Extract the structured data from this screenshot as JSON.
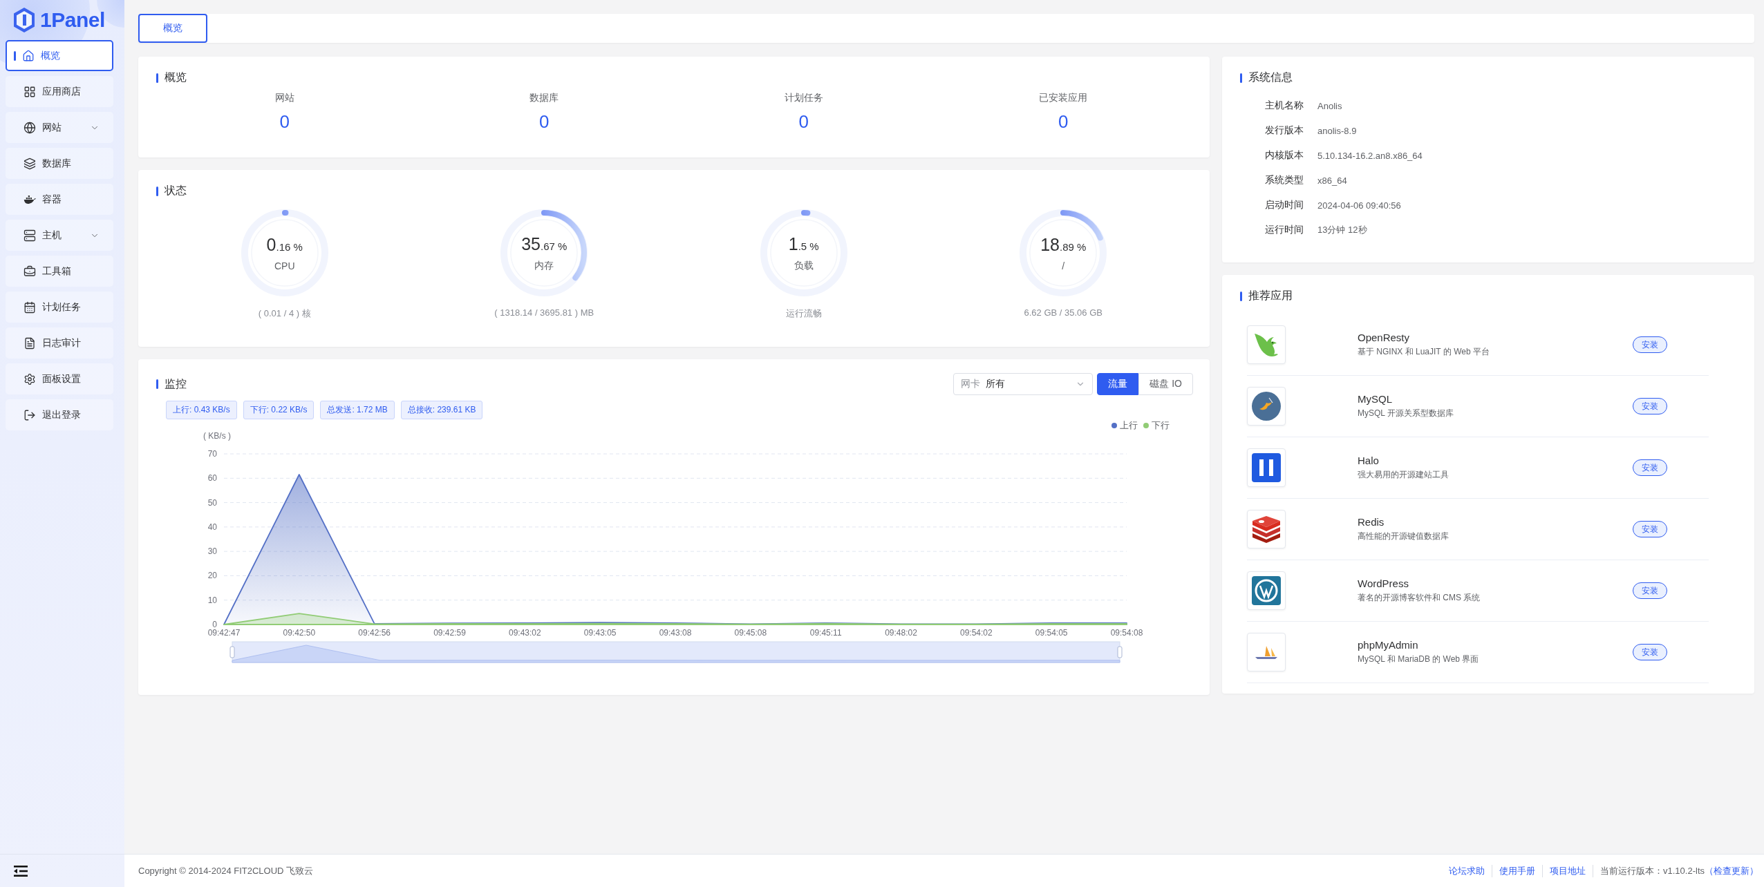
{
  "brand": {
    "name": "1Panel"
  },
  "sidebar": {
    "items": [
      {
        "label": "概览",
        "selected": true,
        "has_submenu": false
      },
      {
        "label": "应用商店",
        "selected": false,
        "has_submenu": false
      },
      {
        "label": "网站",
        "selected": false,
        "has_submenu": true
      },
      {
        "label": "数据库",
        "selected": false,
        "has_submenu": false
      },
      {
        "label": "容器",
        "selected": false,
        "has_submenu": false
      },
      {
        "label": "主机",
        "selected": false,
        "has_submenu": true
      },
      {
        "label": "工具箱",
        "selected": false,
        "has_submenu": false
      },
      {
        "label": "计划任务",
        "selected": false,
        "has_submenu": false
      },
      {
        "label": "日志审计",
        "selected": false,
        "has_submenu": false
      },
      {
        "label": "面板设置",
        "selected": false,
        "has_submenu": false
      },
      {
        "label": "退出登录",
        "selected": false,
        "has_submenu": false
      }
    ]
  },
  "top_tabs": [
    {
      "label": "概览",
      "selected": true
    }
  ],
  "overview": {
    "title": "概览",
    "stats": [
      {
        "label": "网站",
        "value": "0"
      },
      {
        "label": "数据库",
        "value": "0"
      },
      {
        "label": "计划任务",
        "value": "0"
      },
      {
        "label": "已安装应用",
        "value": "0"
      }
    ]
  },
  "status": {
    "title": "状态",
    "gauges": [
      {
        "integer": "0",
        "fraction": ".16 %",
        "label": "CPU",
        "level": 0.0016,
        "detail": "( 0.01 / 4 ) 核"
      },
      {
        "integer": "35",
        "fraction": ".67 %",
        "label": "内存",
        "level": 0.3567,
        "detail": "( 1318.14 / 3695.81 ) MB"
      },
      {
        "integer": "1",
        "fraction": ".5 %",
        "label": "负载",
        "level": 0.015,
        "detail": "运行流畅"
      },
      {
        "integer": "18",
        "fraction": ".89 %",
        "label": "/",
        "level": 0.1889,
        "detail": "6.62 GB / 35.06 GB"
      }
    ]
  },
  "monitor": {
    "title": "监控",
    "nic_select": {
      "label": "网卡",
      "value": "所有"
    },
    "modes": [
      {
        "label": "流量",
        "selected": true
      },
      {
        "label": "磁盘 IO",
        "selected": false
      }
    ],
    "tags": [
      "上行: 0.43 KB/s",
      "下行: 0.22 KB/s",
      "总发送: 1.72 MB",
      "总接收: 239.61 KB"
    ],
    "chart_data": {
      "type": "area",
      "ylabel": "( KB/s )",
      "categories": [
        "09:42:47",
        "09:42:50",
        "09:42:56",
        "09:42:59",
        "09:43:02",
        "09:43:05",
        "09:43:08",
        "09:45:08",
        "09:45:11",
        "09:48:02",
        "09:54:02",
        "09:54:05",
        "09:54:08"
      ],
      "series": [
        {
          "name": "上行",
          "color": "#5470c6",
          "values": [
            0,
            61.5,
            0.3,
            0.5,
            0.6,
            0.8,
            0.6,
            0.2,
            0.6,
            0.2,
            0.2,
            0.6,
            0.6
          ]
        },
        {
          "name": "下行",
          "color": "#91cc75",
          "values": [
            0,
            4.5,
            0.2,
            0.3,
            0.3,
            0.4,
            0.3,
            0.1,
            0.4,
            0.1,
            0.1,
            0.3,
            0.3
          ]
        }
      ],
      "ylim": [
        0,
        70
      ],
      "grid": true,
      "yticks": [
        0,
        10,
        20,
        30,
        40,
        50,
        60,
        70
      ]
    }
  },
  "system_info": {
    "title": "系统信息",
    "rows": [
      {
        "label": "主机名称",
        "value": "Anolis"
      },
      {
        "label": "发行版本",
        "value": "anolis-8.9"
      },
      {
        "label": "内核版本",
        "value": "5.10.134-16.2.an8.x86_64"
      },
      {
        "label": "系统类型",
        "value": "x86_64"
      },
      {
        "label": "启动时间",
        "value": "2024-04-06 09:40:56"
      },
      {
        "label": "运行时间",
        "value": "13分钟 12秒"
      }
    ]
  },
  "recommended": {
    "title": "推荐应用",
    "apps": [
      {
        "name": "OpenResty",
        "description": "基于 NGINX 和 LuaJIT 的 Web 平台",
        "action": "安装"
      },
      {
        "name": "MySQL",
        "description": "MySQL 开源关系型数据库",
        "action": "安装"
      },
      {
        "name": "Halo",
        "description": "强大易用的开源建站工具",
        "action": "安装"
      },
      {
        "name": "Redis",
        "description": "高性能的开源键值数据库",
        "action": "安装"
      },
      {
        "name": "WordPress",
        "description": "著名的开源博客软件和 CMS 系统",
        "action": "安装"
      },
      {
        "name": "phpMyAdmin",
        "description": "MySQL 和 MariaDB 的 Web 界面",
        "action": "安装"
      }
    ]
  },
  "footer": {
    "copyright": "Copyright © 2014-2024 FIT2CLOUD 飞致云",
    "links": [
      "论坛求助",
      "使用手册",
      "项目地址"
    ],
    "version": "当前运行版本：v1.10.2-lts",
    "update_link": "（检查更新）"
  }
}
